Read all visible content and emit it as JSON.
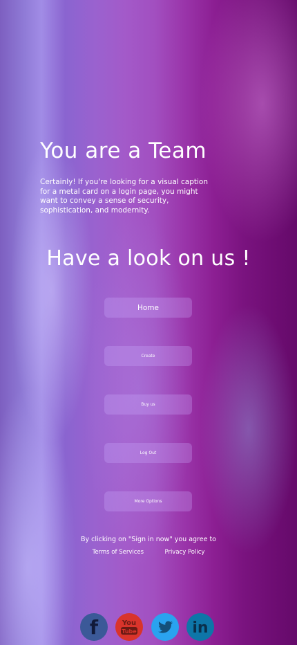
{
  "hero": {
    "title": "You are a Team",
    "caption": "Certainly! If you're looking for a visual caption for a metal card on a login page, you might want to convey a sense of security, sophistication, and modernity."
  },
  "section": {
    "title": "Have a look on us !"
  },
  "menu": {
    "items": [
      {
        "label": "Home"
      },
      {
        "label": "Create"
      },
      {
        "label": "Buy us"
      },
      {
        "label": "Log Out"
      },
      {
        "label": "More Options"
      }
    ]
  },
  "terms": {
    "notice": "By clicking on \"Sign in now\" you agree to",
    "terms_link": "Terms of Services",
    "privacy_link": "Privacy Policy"
  },
  "social": {
    "icons": [
      "facebook-icon",
      "youtube-icon",
      "twitter-icon",
      "linkedin-icon"
    ],
    "youtube_text": {
      "top": "You",
      "bottom": "Tube"
    },
    "linkedin_text": "in",
    "facebook_text": "f",
    "colors": {
      "facebook": "#3b5998",
      "youtube": "#d9342b",
      "twitter": "#2aa3ef",
      "linkedin": "#0e76a8"
    }
  }
}
